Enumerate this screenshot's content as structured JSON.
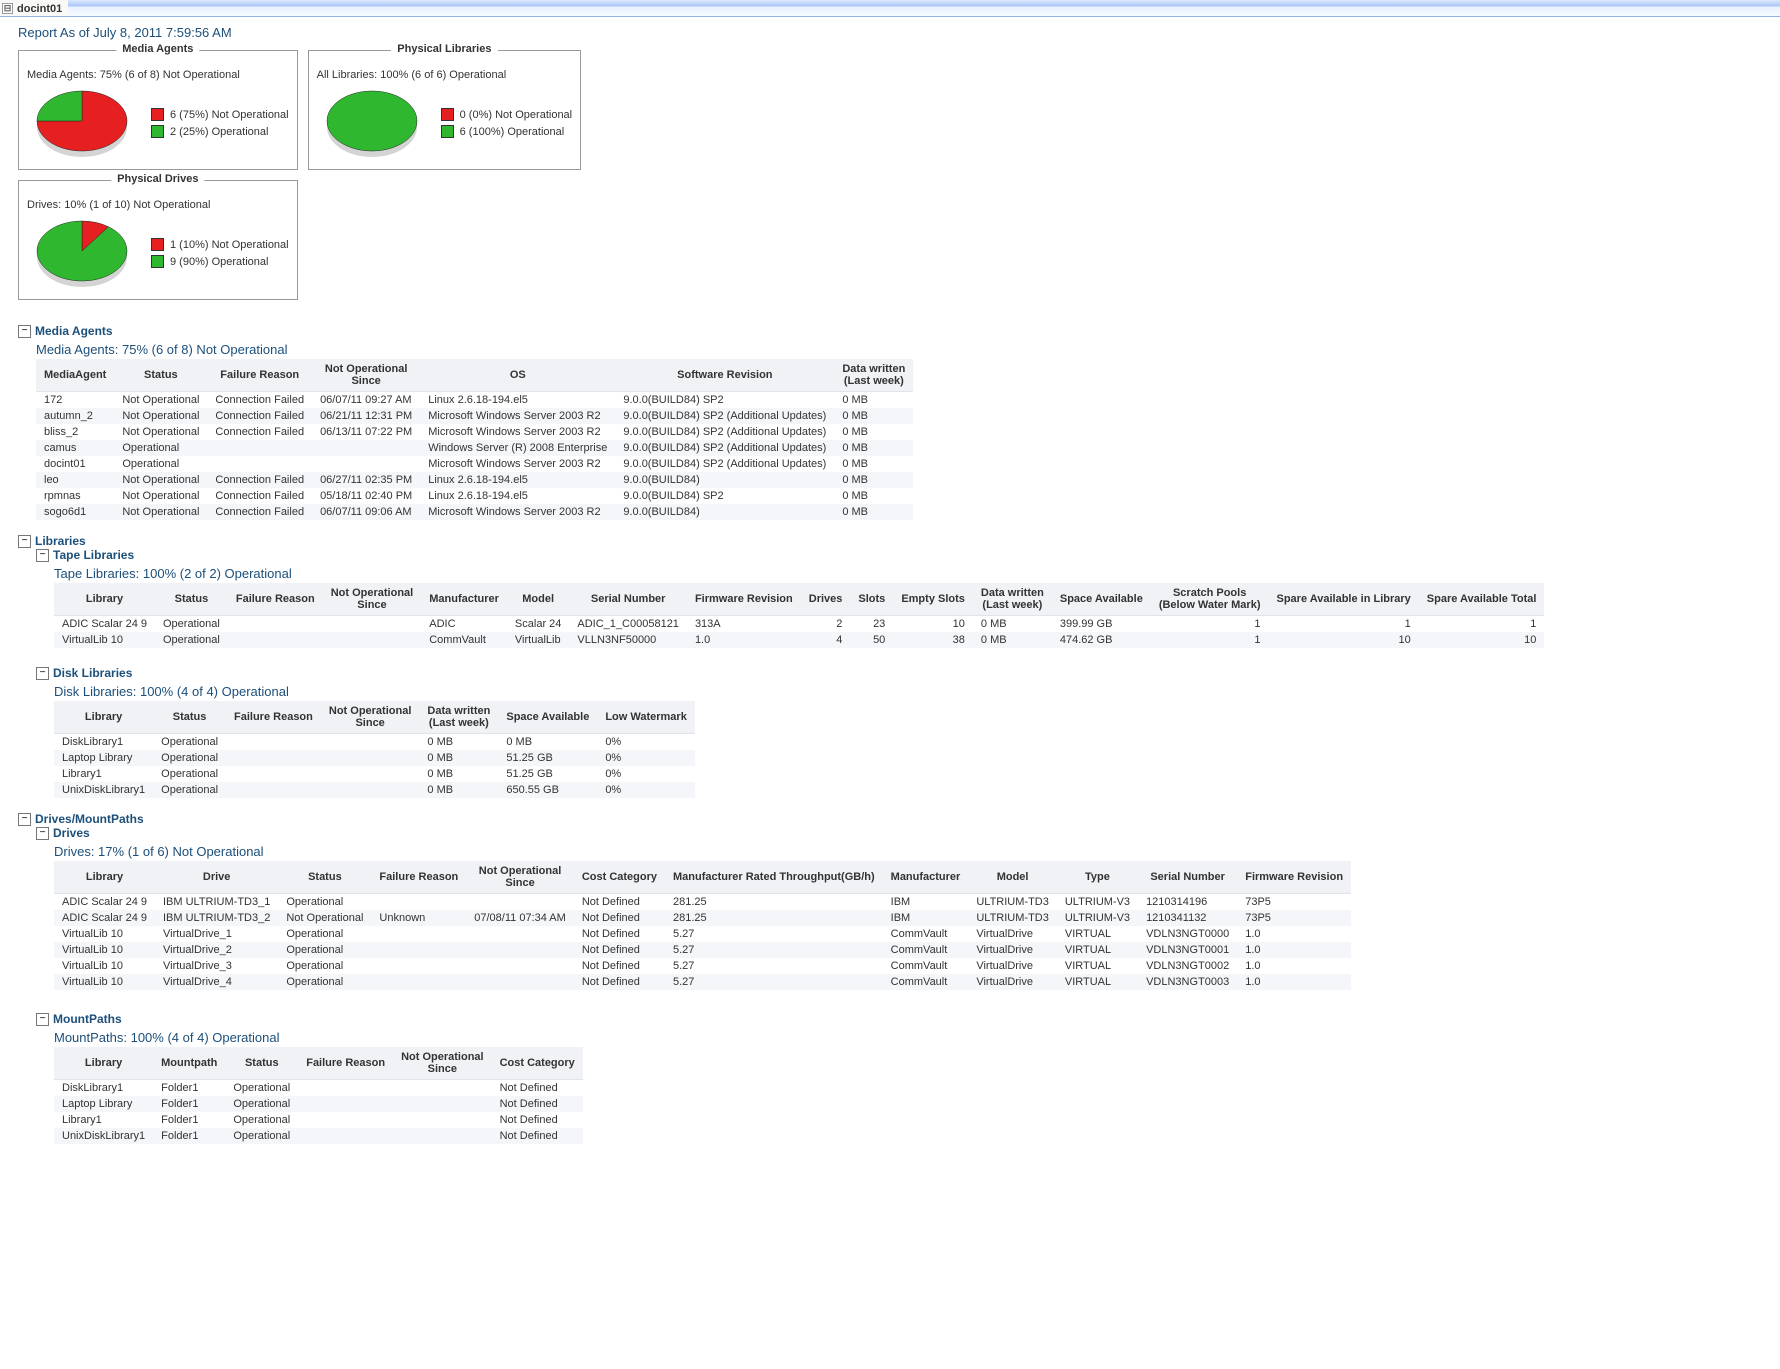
{
  "window": {
    "host": "docint01",
    "toggleGlyph": "⊟"
  },
  "report": {
    "asof": "Report As of July 8, 2011 7:59:56 AM"
  },
  "colors": {
    "notOperational": "#e62020",
    "operational": "#2fb82f"
  },
  "summaries": [
    {
      "id": "media-agents",
      "title": "Media Agents",
      "caption": "Media Agents: 75% (6 of 8) Not Operational",
      "legend": [
        {
          "label": "6 (75%) Not Operational",
          "color": "red"
        },
        {
          "label": "2 (25%) Operational",
          "color": "green"
        }
      ],
      "chart_data": {
        "type": "pie",
        "title": "Media Agents",
        "categories": [
          "Not Operational",
          "Operational"
        ],
        "values": [
          6,
          2
        ],
        "colors": [
          "#e62020",
          "#2fb82f"
        ]
      }
    },
    {
      "id": "physical-libraries",
      "title": "Physical Libraries",
      "caption": "All Libraries: 100% (6 of 6) Operational",
      "legend": [
        {
          "label": "0 (0%) Not Operational",
          "color": "red"
        },
        {
          "label": "6 (100%) Operational",
          "color": "green"
        }
      ],
      "chart_data": {
        "type": "pie",
        "title": "Physical Libraries",
        "categories": [
          "Not Operational",
          "Operational"
        ],
        "values": [
          0,
          6
        ],
        "colors": [
          "#e62020",
          "#2fb82f"
        ]
      }
    },
    {
      "id": "physical-drives",
      "title": "Physical Drives",
      "caption": "Drives: 10% (1 of 10) Not Operational",
      "legend": [
        {
          "label": "1 (10%) Not Operational",
          "color": "red"
        },
        {
          "label": "9 (90%) Operational",
          "color": "green"
        }
      ],
      "chart_data": {
        "type": "pie",
        "title": "Physical Drives",
        "categories": [
          "Not Operational",
          "Operational"
        ],
        "values": [
          1,
          9
        ],
        "colors": [
          "#e62020",
          "#2fb82f"
        ]
      }
    }
  ],
  "sections": {
    "mediaAgents": {
      "heading": "Media Agents",
      "status": "Media Agents: 75% (6 of 8) Not Operational",
      "columns": [
        "MediaAgent",
        "Status",
        "Failure Reason",
        "Not Operational Since",
        "OS",
        "Software Revision",
        "Data written (Last week)"
      ],
      "rows": [
        [
          "172",
          "Not Operational",
          "Connection Failed",
          "06/07/11 09:27 AM",
          "Linux 2.6.18-194.el5",
          "9.0.0(BUILD84) SP2",
          "0 MB"
        ],
        [
          "autumn_2",
          "Not Operational",
          "Connection Failed",
          "06/21/11 12:31 PM",
          "Microsoft Windows Server 2003 R2",
          "9.0.0(BUILD84) SP2 (Additional Updates)",
          "0 MB"
        ],
        [
          "bliss_2",
          "Not Operational",
          "Connection Failed",
          "06/13/11 07:22 PM",
          "Microsoft Windows Server 2003 R2",
          "9.0.0(BUILD84) SP2 (Additional Updates)",
          "0 MB"
        ],
        [
          "camus",
          "Operational",
          "",
          "",
          "Windows Server (R) 2008 Enterprise",
          "9.0.0(BUILD84) SP2 (Additional Updates)",
          "0 MB"
        ],
        [
          "docint01",
          "Operational",
          "",
          "",
          "Microsoft Windows Server 2003 R2",
          "9.0.0(BUILD84) SP2 (Additional Updates)",
          "0 MB"
        ],
        [
          "leo",
          "Not Operational",
          "Connection Failed",
          "06/27/11 02:35 PM",
          "Linux 2.6.18-194.el5",
          "9.0.0(BUILD84)",
          "0 MB"
        ],
        [
          "rpmnas",
          "Not Operational",
          "Connection Failed",
          "05/18/11 02:40 PM",
          "Linux 2.6.18-194.el5",
          "9.0.0(BUILD84) SP2",
          "0 MB"
        ],
        [
          "sogo6d1",
          "Not Operational",
          "Connection Failed",
          "06/07/11 09:06 AM",
          "Microsoft Windows Server 2003 R2",
          "9.0.0(BUILD84)",
          "0 MB"
        ]
      ]
    },
    "libraries": {
      "heading": "Libraries"
    },
    "tapeLibraries": {
      "heading": "Tape Libraries",
      "status": "Tape Libraries: 100% (2 of 2) Operational",
      "columns": [
        "Library",
        "Status",
        "Failure Reason",
        "Not Operational Since",
        "Manufacturer",
        "Model",
        "Serial Number",
        "Firmware Revision",
        "Drives",
        "Slots",
        "Empty Slots",
        "Data written (Last week)",
        "Space Available",
        "Scratch Pools (Below Water Mark)",
        "Spare Available in Library",
        "Spare Available Total"
      ],
      "rows": [
        [
          "ADIC Scalar 24 9",
          "Operational",
          "",
          "",
          "ADIC",
          "Scalar 24",
          "ADIC_1_C00058121",
          "313A",
          "2",
          "23",
          "10",
          "0 MB",
          "399.99 GB",
          "1",
          "1",
          "1"
        ],
        [
          "VirtualLib 10",
          "Operational",
          "",
          "",
          "CommVault",
          "VirtualLib",
          "VLLN3NF50000",
          "1.0",
          "4",
          "50",
          "38",
          "0 MB",
          "474.62 GB",
          "1",
          "10",
          "10"
        ]
      ],
      "numCols": [
        8,
        9,
        10,
        13,
        14,
        15
      ]
    },
    "diskLibraries": {
      "heading": "Disk Libraries",
      "status": "Disk Libraries: 100% (4 of 4) Operational",
      "columns": [
        "Library",
        "Status",
        "Failure Reason",
        "Not Operational Since",
        "Data written (Last week)",
        "Space Available",
        "Low Watermark"
      ],
      "rows": [
        [
          "DiskLibrary1",
          "Operational",
          "",
          "",
          "0 MB",
          "0 MB",
          "0%"
        ],
        [
          "Laptop Library",
          "Operational",
          "",
          "",
          "0 MB",
          "51.25 GB",
          "0%"
        ],
        [
          "Library1",
          "Operational",
          "",
          "",
          "0 MB",
          "51.25 GB",
          "0%"
        ],
        [
          "UnixDiskLibrary1",
          "Operational",
          "",
          "",
          "0 MB",
          "650.55 GB",
          "0%"
        ]
      ]
    },
    "drivesMount": {
      "heading": "Drives/MountPaths"
    },
    "drives": {
      "heading": "Drives",
      "status": "Drives: 17% (1 of 6) Not Operational",
      "columns": [
        "Library",
        "Drive",
        "Status",
        "Failure Reason",
        "Not Operational Since",
        "Cost Category",
        "Manufacturer Rated Throughput(GB/h)",
        "Manufacturer",
        "Model",
        "Type",
        "Serial Number",
        "Firmware Revision"
      ],
      "rows": [
        [
          "ADIC Scalar 24 9",
          "IBM ULTRIUM-TD3_1",
          "Operational",
          "",
          "",
          "Not Defined",
          "281.25",
          "IBM",
          "ULTRIUM-TD3",
          "ULTRIUM-V3",
          "1210314196",
          "73P5"
        ],
        [
          "ADIC Scalar 24 9",
          "IBM ULTRIUM-TD3_2",
          "Not Operational",
          "Unknown",
          "07/08/11 07:34 AM",
          "Not Defined",
          "281.25",
          "IBM",
          "ULTRIUM-TD3",
          "ULTRIUM-V3",
          "1210341132",
          "73P5"
        ],
        [
          "VirtualLib 10",
          "VirtualDrive_1",
          "Operational",
          "",
          "",
          "Not Defined",
          "5.27",
          "CommVault",
          "VirtualDrive",
          "VIRTUAL",
          "VDLN3NGT0000",
          "1.0"
        ],
        [
          "VirtualLib 10",
          "VirtualDrive_2",
          "Operational",
          "",
          "",
          "Not Defined",
          "5.27",
          "CommVault",
          "VirtualDrive",
          "VIRTUAL",
          "VDLN3NGT0001",
          "1.0"
        ],
        [
          "VirtualLib 10",
          "VirtualDrive_3",
          "Operational",
          "",
          "",
          "Not Defined",
          "5.27",
          "CommVault",
          "VirtualDrive",
          "VIRTUAL",
          "VDLN3NGT0002",
          "1.0"
        ],
        [
          "VirtualLib 10",
          "VirtualDrive_4",
          "Operational",
          "",
          "",
          "Not Defined",
          "5.27",
          "CommVault",
          "VirtualDrive",
          "VIRTUAL",
          "VDLN3NGT0003",
          "1.0"
        ]
      ]
    },
    "mountPaths": {
      "heading": "MountPaths",
      "status": "MountPaths: 100% (4 of 4) Operational",
      "columns": [
        "Library",
        "Mountpath",
        "Status",
        "Failure Reason",
        "Not Operational Since",
        "Cost Category"
      ],
      "rows": [
        [
          "DiskLibrary1",
          "Folder1",
          "Operational",
          "",
          "",
          "Not Defined"
        ],
        [
          "Laptop Library",
          "Folder1",
          "Operational",
          "",
          "",
          "Not Defined"
        ],
        [
          "Library1",
          "Folder1",
          "Operational",
          "",
          "",
          "Not Defined"
        ],
        [
          "UnixDiskLibrary1",
          "Folder1",
          "Operational",
          "",
          "",
          "Not Defined"
        ]
      ]
    }
  },
  "glyphs": {
    "minus": "−"
  }
}
